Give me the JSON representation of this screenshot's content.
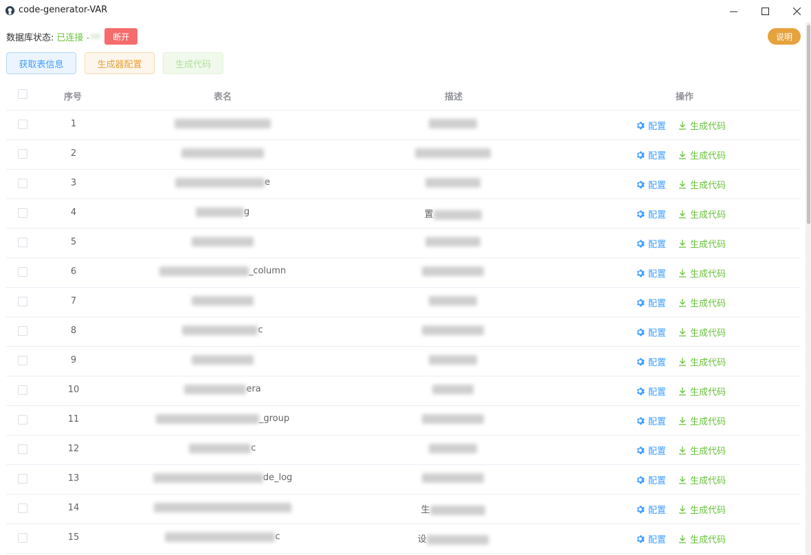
{
  "window": {
    "title": "code-generator-VAR"
  },
  "status": {
    "label": "数据库状态:",
    "value": "已连接 - ",
    "disconnect_label": "断开",
    "help_label": "说明"
  },
  "toolbar": {
    "fetch_label": "获取表信息",
    "config_label": "生成器配置",
    "generate_label": "生成代码"
  },
  "table": {
    "headers": {
      "index": "序号",
      "name": "表名",
      "desc": "描述",
      "ops": "操作"
    },
    "op_config_label": "配置",
    "op_generate_label": "生成代码",
    "rows": [
      {
        "index": "1",
        "name": "",
        "desc": ""
      },
      {
        "index": "2",
        "name": "",
        "desc": ""
      },
      {
        "index": "3",
        "name": "e",
        "desc": ""
      },
      {
        "index": "4",
        "name": "g",
        "desc": "置"
      },
      {
        "index": "5",
        "name": "",
        "desc": ""
      },
      {
        "index": "6",
        "name": "_column",
        "desc": ""
      },
      {
        "index": "7",
        "name": "",
        "desc": ""
      },
      {
        "index": "8",
        "name": "c",
        "desc": ""
      },
      {
        "index": "9",
        "name": "",
        "desc": ""
      },
      {
        "index": "10",
        "name": "era",
        "desc": ""
      },
      {
        "index": "11",
        "name": "_group",
        "desc": ""
      },
      {
        "index": "12",
        "name": "c",
        "desc": ""
      },
      {
        "index": "13",
        "name": "de_log",
        "desc": ""
      },
      {
        "index": "14",
        "name": "",
        "desc": "生"
      },
      {
        "index": "15",
        "name": "c",
        "desc": "设"
      }
    ]
  },
  "colors": {
    "primary": "#409eff",
    "success": "#67c23a",
    "warning": "#e6a23c",
    "danger": "#f56c6c"
  }
}
